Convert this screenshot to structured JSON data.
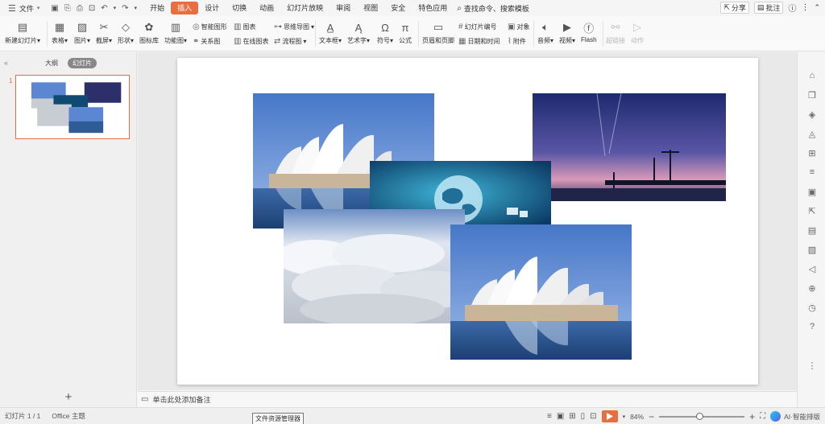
{
  "menu": {
    "file_label": "文件",
    "tabs": [
      "开始",
      "插入",
      "设计",
      "切换",
      "动画",
      "幻灯片放映",
      "审阅",
      "视图",
      "安全",
      "特色应用"
    ],
    "active_tab": "插入",
    "search_label": "查找命令、搜索模板",
    "share_label": "分享",
    "comment_label": "批注"
  },
  "ribbon": {
    "new_slide": "新建幻灯片",
    "table": "表格",
    "picture": "图片",
    "screenshot": "截屏",
    "shape": "形状",
    "icon_lib": "图标库",
    "func_chart": "功能图",
    "smart_art": "智能图形",
    "chart": "图表",
    "mind_map": "思维导图",
    "relation": "关系图",
    "online_chart": "在线图表",
    "flow_chart": "流程图",
    "textbox": "文本框",
    "word_art": "艺术字",
    "symbol": "符号",
    "formula": "公式",
    "header_footer": "页眉和页脚",
    "slide_number": "幻灯片编号",
    "object": "对象",
    "date_time": "日期和时间",
    "attachment": "附件",
    "audio": "音频",
    "video": "视频",
    "flash": "Flash",
    "hyperlink": "超链接",
    "action": "动作"
  },
  "left_panel": {
    "tab_outline": "大纲",
    "tab_slides": "幻灯片",
    "slide_number": "1"
  },
  "notes_placeholder": "单击此处添加备注",
  "status": {
    "slide_info": "幻灯片 1 / 1",
    "theme": "Office 主题",
    "tooltip": "文件资源管理器",
    "zoom": "84%",
    "zoom_fraction": 0.48,
    "ai_label": "AI·智能排版"
  },
  "colors": {
    "accent": "#e96e3f",
    "sky": "#4f7fcf",
    "night": "#2a2f6a"
  }
}
